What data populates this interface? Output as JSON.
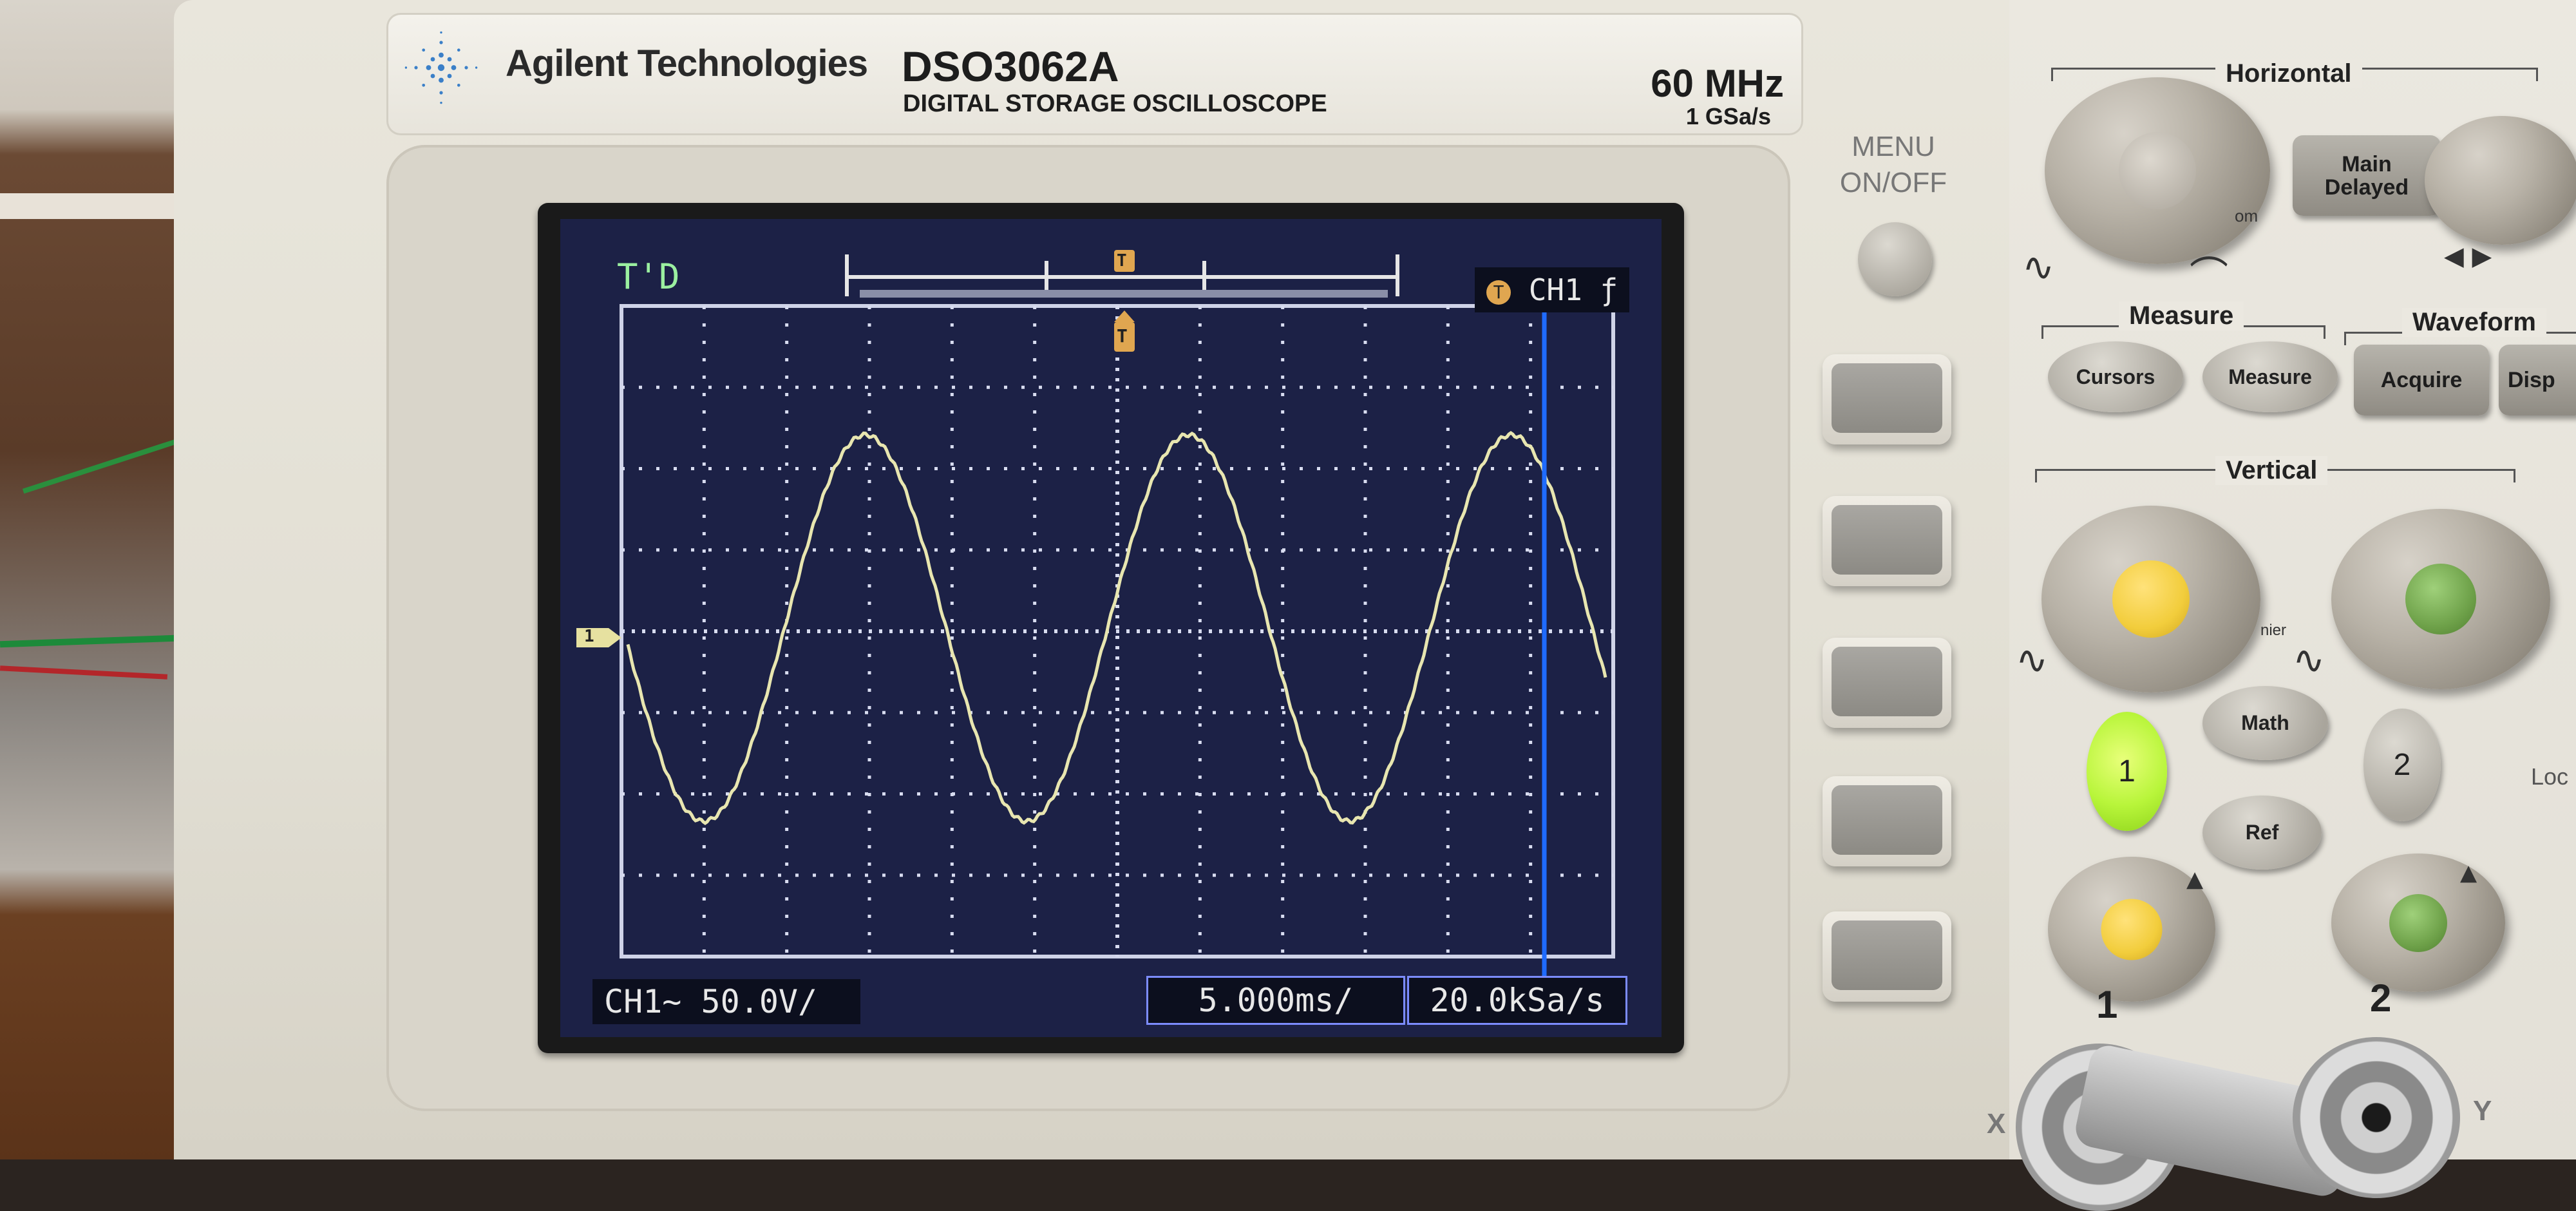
{
  "instrument": {
    "brand": "Agilent Technologies",
    "model": "DSO3062A",
    "model_subtitle": "DIGITAL STORAGE OSCILLOSCOPE",
    "bandwidth": "60 MHz",
    "sample_rate_spec": "1 GSa/s"
  },
  "screen": {
    "status": "T'D",
    "trigger": "CH1",
    "trigger_marker": "T",
    "channel_marker": "1",
    "channel_scale": "CH1~  50.0V/",
    "timebase": "5.000ms/",
    "sample_rate": "20.0kSa/s"
  },
  "waveform": {
    "type": "sine",
    "cycles_visible": 3,
    "color": "#e8e6b0"
  },
  "panel": {
    "menu_label": "MENU\nON/OFF",
    "horizontal": {
      "label": "Horizontal",
      "main_delayed": "Main\nDelayed"
    },
    "measure": {
      "label": "Measure",
      "cursors": "Cursors",
      "measure": "Measure"
    },
    "waveform_section": {
      "label": "Waveform",
      "acquire": "Acquire",
      "display": "Disp"
    },
    "vertical": {
      "label": "Vertical",
      "math": "Math",
      "ref": "Ref",
      "ch1": "1",
      "ch2": "2"
    },
    "channel_numbers": [
      "1",
      "2"
    ],
    "input_labels": [
      "X",
      "Y"
    ],
    "partial_labels": {
      "knob_text": "om",
      "vernier": "nier",
      "lock": "Loc"
    }
  },
  "colors": {
    "screen_bg": "#1c2146",
    "ch1_yellow": "#f2cd3c",
    "ch2_green": "#6fa24a",
    "ch1_button_lit": "#b8f53a",
    "cursor_blue": "#1f6bff"
  }
}
